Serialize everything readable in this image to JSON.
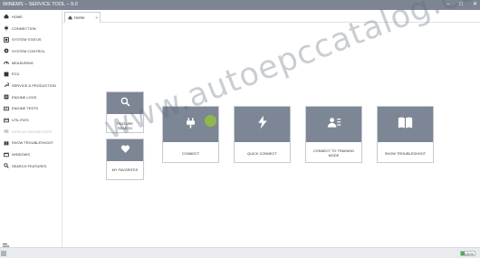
{
  "window": {
    "title": "WINEMS – SERVICE TOOL – 9.0",
    "controls": [
      "–",
      "□",
      "✕"
    ]
  },
  "sidebar": {
    "items": [
      {
        "label": "HOME",
        "icon": "home-icon",
        "enabled": true
      },
      {
        "label": "CONNECTION",
        "icon": "plug-icon",
        "enabled": true
      },
      {
        "label": "SYSTEM STATUS",
        "icon": "status-icon",
        "enabled": true
      },
      {
        "label": "SYSTEM CONTROL",
        "icon": "control-icon",
        "enabled": true
      },
      {
        "label": "MEASURING",
        "icon": "gauge-icon",
        "enabled": true
      },
      {
        "label": "ECU",
        "icon": "chip-icon",
        "enabled": true
      },
      {
        "label": "SERVICE & PRODUCTION",
        "icon": "wrench-icon",
        "enabled": true
      },
      {
        "label": "ENGINE LOGS",
        "icon": "logs-icon",
        "enabled": true
      },
      {
        "label": "ENGINE TESTS",
        "icon": "tests-icon",
        "enabled": true
      },
      {
        "label": "UTILITIES",
        "icon": "utilities-icon",
        "enabled": true
      },
      {
        "label": "DISPLAY PARAMETERS",
        "icon": "display-icon",
        "enabled": false
      },
      {
        "label": "SHOW TROUBLESHOOT",
        "icon": "book-icon",
        "enabled": true
      },
      {
        "label": "WINDOWS",
        "icon": "windows-icon",
        "enabled": true
      },
      {
        "label": "SEARCH FEATURES",
        "icon": "search-icon",
        "enabled": true
      }
    ]
  },
  "tabs": [
    {
      "label": "Home",
      "icon": "home-icon"
    }
  ],
  "tiles": {
    "feature_search": {
      "label": "FEATURE SEARCH",
      "icon": "search-icon"
    },
    "my_favorites": {
      "label": "MY FAVORITES",
      "icon": "heart-icon"
    },
    "connect": {
      "label": "CONNECT",
      "icon": "plug-icon"
    },
    "quick_connect": {
      "label": "QUICK CONNECT",
      "icon": "lightning-icon"
    },
    "training": {
      "label": "CONNECT TO TRAINING MODE",
      "icon": "user-card-icon"
    },
    "troubleshoot": {
      "label": "SHOW TROUBLESHOOT",
      "icon": "book-icon"
    }
  },
  "status": {
    "progress_text": "100%",
    "progress_fraction": 0.25
  },
  "watermark": "www.autoepccatalog.com",
  "colors": {
    "tile_header": "#7d8694",
    "titlebar": "#7c8591",
    "progress": "#48b04a"
  }
}
